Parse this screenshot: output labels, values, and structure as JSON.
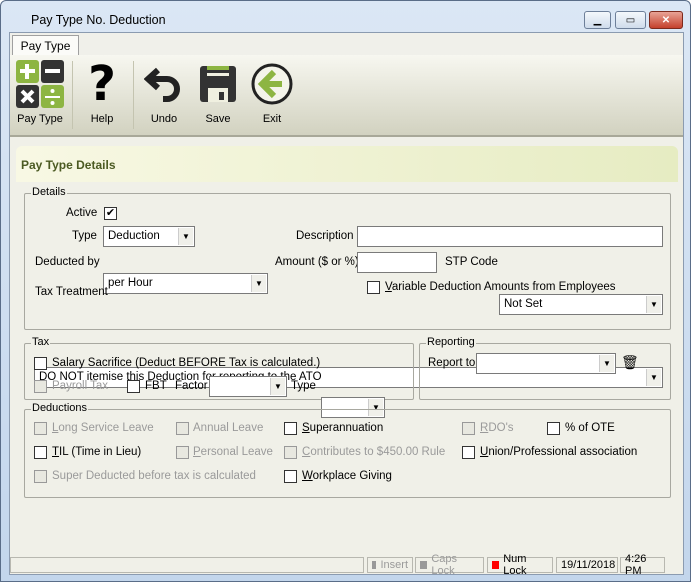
{
  "window": {
    "title": "Pay Type No.  Deduction"
  },
  "tab": "Pay Type",
  "toolbar": {
    "pay_type": "Pay Type",
    "help": "Help",
    "undo": "Undo",
    "save": "Save",
    "exit": "Exit"
  },
  "header": "Pay Type Details",
  "details": {
    "legend": "Details",
    "active_label": "Active",
    "active": true,
    "type_label": "Type",
    "type_value": "Deduction",
    "description_label": "Description",
    "description_value": "",
    "deducted_by_label": "Deducted by",
    "deducted_by_value": "per Hour",
    "amount_label": "Amount ($ or %)",
    "amount_value": "",
    "stp_label": "STP Code",
    "stp_value": "Not Set",
    "tax_treatment_label": "Tax Treatment",
    "variable_label": "Variable Deduction Amounts from Employees",
    "tax_treatment_value": "DO NOT itemise this Deduction for reporting to the ATO"
  },
  "tax": {
    "legend": "Tax",
    "salary_sacrifice": "Salary Sacrifice (Deduct BEFORE Tax is calculated.)",
    "payroll_tax": "Payroll Tax",
    "fbt": "FBT",
    "factor_label": "Factor",
    "type_label": "Type"
  },
  "reporting": {
    "legend": "Reporting",
    "report_to_label": "Report to",
    "report_to_value": ""
  },
  "deductions": {
    "legend": "Deductions",
    "long_service": "Long Service Leave",
    "annual": "Annual Leave",
    "super": "Superannuation",
    "rdo": "RDO's",
    "ote": "% of OTE",
    "til": "TIL (Time in Lieu)",
    "personal": "Personal Leave",
    "contributes": "Contributes to $450.00 Rule",
    "union": "Union/Professional association",
    "super_deducted": "Super Deducted before tax is calculated",
    "workplace": "Workplace Giving"
  },
  "status": {
    "insert": "Insert",
    "caps": "Caps Lock",
    "num": "Num Lock",
    "date": "19/11/2018",
    "time": "4:26 PM"
  },
  "colors": {
    "accent_green": "#8db542",
    "num_lock": "#ff0000"
  }
}
